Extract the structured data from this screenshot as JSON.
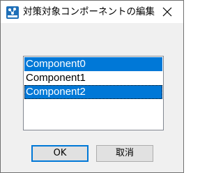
{
  "window": {
    "title": "対策対象コンポーネントの編集",
    "icon": "app-network-icon"
  },
  "list": {
    "items": [
      {
        "label": "Component0",
        "selected": true
      },
      {
        "label": "Component1",
        "selected": false
      },
      {
        "label": "Component2",
        "selected": true,
        "focused": true
      }
    ]
  },
  "buttons": {
    "ok_label": "OK",
    "cancel_label": "取消"
  },
  "colors": {
    "selection": "#0078d7",
    "window_bg": "#f0f0f0"
  }
}
